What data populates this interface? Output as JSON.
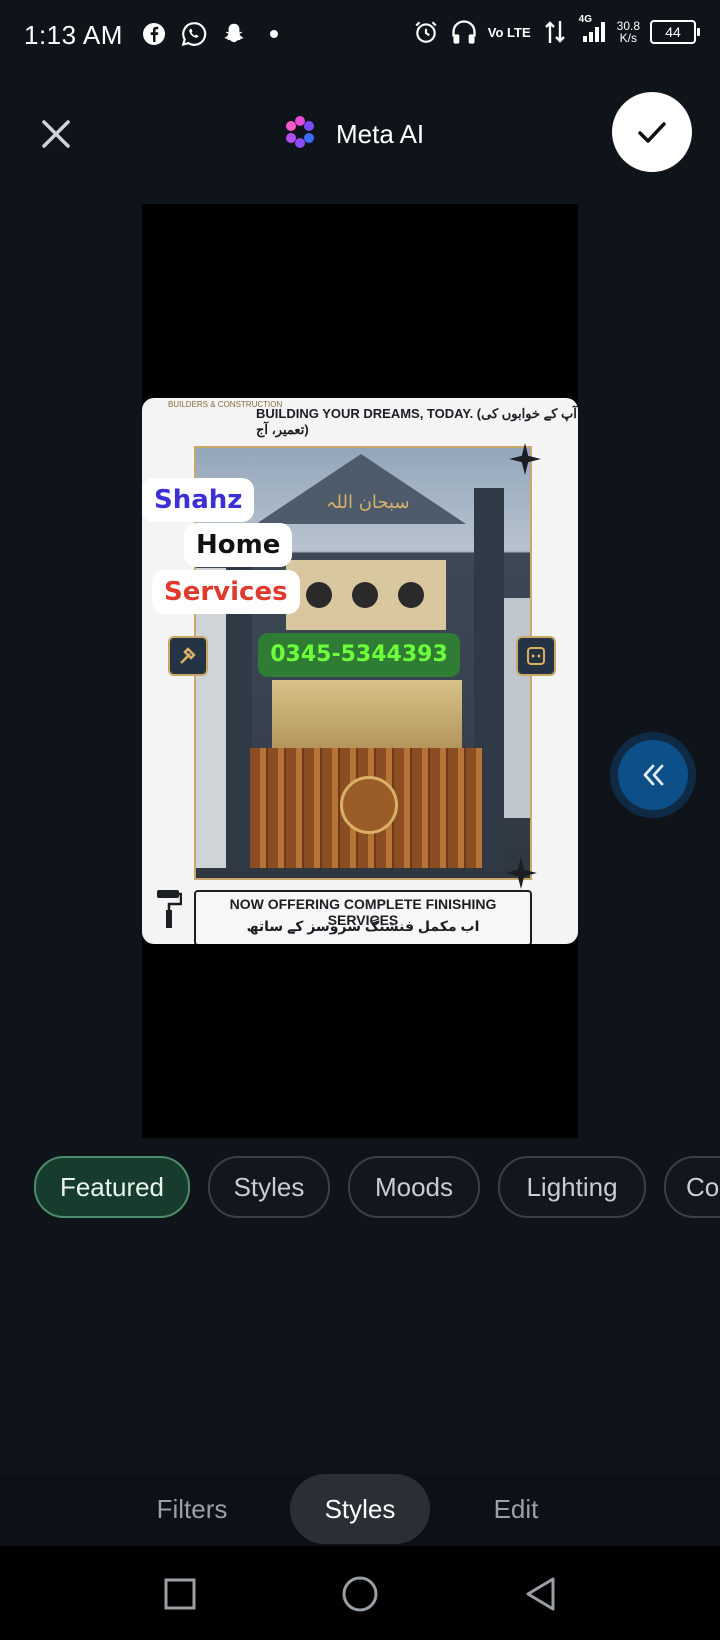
{
  "status_bar": {
    "time": "1:13 AM",
    "app_icons": [
      "facebook-icon",
      "whatsapp-icon",
      "snapchat-icon",
      "dot-icon"
    ],
    "network": "Vo LTE",
    "signal": "4G",
    "speed_value": "30.8",
    "speed_unit": "K/s",
    "battery": "44"
  },
  "header": {
    "title": "Meta AI",
    "close_icon": "close-icon",
    "confirm_icon": "check-icon",
    "logo_icon": "meta-ai-logo-icon"
  },
  "poster": {
    "headline": "BUILDING YOUR DREAMS, TODAY. (آپ کے خوابوں کی تعمیر، آج)",
    "brand": "BUILDERS & CONSTRUCTION",
    "bottom_line1": "NOW OFFERING COMPLETE FINISHING SERVICES",
    "bottom_line2": "اب مکمل فنشنگ سروسز کے ساتھ",
    "calligraphy": "سبحان اللہ"
  },
  "stickers": {
    "line1": "Shahz",
    "line2": "Home",
    "line3": "Services",
    "phone": "0345-5344393"
  },
  "colors": {
    "background": "#0f141b",
    "accent_active_chip": "#173b2c",
    "sticker_blue": "#3b2fd6",
    "sticker_red": "#e03a2f",
    "phone_green": "#6dff3a"
  },
  "chips": [
    {
      "label": "Featured",
      "active": true
    },
    {
      "label": "Styles",
      "active": false
    },
    {
      "label": "Moods",
      "active": false
    },
    {
      "label": "Lighting",
      "active": false
    },
    {
      "label": "Co",
      "active": false
    }
  ],
  "tabs": [
    {
      "label": "Filters",
      "active": false
    },
    {
      "label": "Styles",
      "active": true
    },
    {
      "label": "Edit",
      "active": false
    }
  ],
  "navbar": [
    "recent-apps-icon",
    "home-icon",
    "back-icon"
  ]
}
